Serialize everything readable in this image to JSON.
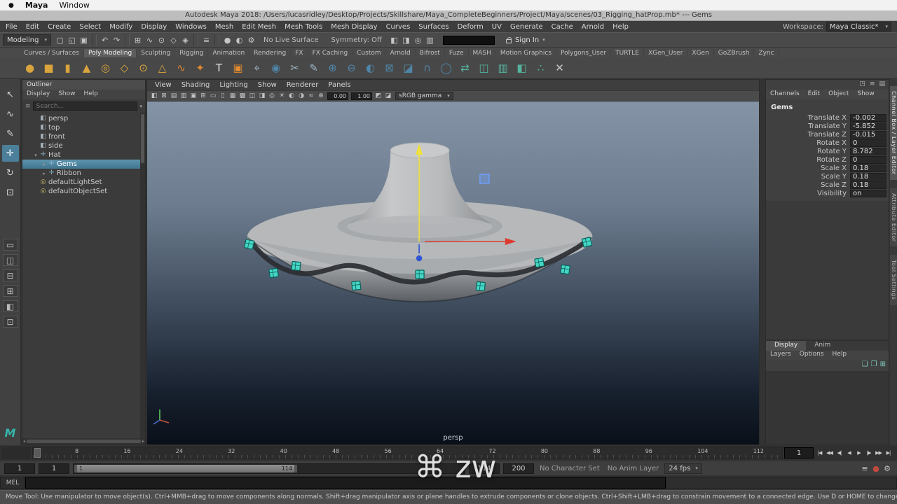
{
  "icons": {
    "chevron_down": "▾",
    "apple": "●",
    "search": "≡"
  },
  "colors": {
    "selection": "#4b7f9a",
    "gem": "#45d6c6",
    "axis_x": "#dd3b2e",
    "axis_y": "#f0e13c",
    "axis_z": "#2f54d6",
    "autokey": "#c2493d"
  },
  "macos_bar": {
    "apple_icon": "●",
    "app_name": "Maya",
    "window_menu": "Window"
  },
  "titlebar": {
    "title": "Autodesk Maya 2018: /Users/lucasridley/Desktop/Projects/Skillshare/Maya_CompleteBeginners/Project/Maya/scenes/03_Rigging_hatProp.mb*  --- Gems"
  },
  "menubar": {
    "items": [
      "File",
      "Edit",
      "Create",
      "Select",
      "Modify",
      "Display",
      "Windows",
      "Mesh",
      "Edit Mesh",
      "Mesh Tools",
      "Mesh Display",
      "Curves",
      "Surfaces",
      "Deform",
      "UV",
      "Generate",
      "Cache",
      "Arnold",
      "Help"
    ],
    "workspace_label": "Workspace:",
    "workspace_value": "Maya Classic*"
  },
  "statusline": {
    "mode": "Modeling",
    "icons": [
      {
        "name": "new-scene-icon",
        "g": "▢"
      },
      {
        "name": "open-scene-icon",
        "g": "◱"
      },
      {
        "name": "save-scene-icon",
        "g": "▣"
      },
      {
        "name": "divider-grip",
        "cls": "divider",
        "g": ""
      },
      {
        "name": "undo-icon",
        "g": "↶"
      },
      {
        "name": "redo-icon",
        "g": "↷"
      },
      {
        "name": "divider-grip",
        "cls": "divider",
        "g": ""
      },
      {
        "name": "snap-grid-icon",
        "g": "⊞"
      },
      {
        "name": "snap-curve-icon",
        "g": "∿"
      },
      {
        "name": "snap-point-icon",
        "g": "⊙"
      },
      {
        "name": "snap-plane-icon",
        "g": "◇"
      },
      {
        "name": "make-live-icon",
        "g": "◈"
      },
      {
        "name": "divider-grip",
        "cls": "divider",
        "g": ""
      },
      {
        "name": "construction-history-icon",
        "g": "≡"
      },
      {
        "name": "divider-grip",
        "cls": "divider",
        "g": ""
      },
      {
        "name": "render-frame-icon",
        "g": "●"
      },
      {
        "name": "ipr-render-icon",
        "g": "◐"
      },
      {
        "name": "render-settings-icon",
        "g": "⚙"
      }
    ],
    "no_live_surface": "No Live Surface",
    "symmetry": "Symmetry: Off",
    "icons_mid": [
      {
        "name": "object-mode-icon",
        "g": "◧"
      },
      {
        "name": "component-mode-icon",
        "g": "◨"
      },
      {
        "name": "highlight-selection-icon",
        "g": "◎"
      },
      {
        "name": "xray-mode-icon",
        "g": "▥"
      }
    ],
    "sign_in": "Sign In"
  },
  "shelf": {
    "tabs": [
      {
        "label": "Curves / Surfaces"
      },
      {
        "label": "Poly Modeling",
        "active": true
      },
      {
        "label": "Sculpting"
      },
      {
        "label": "Rigging"
      },
      {
        "label": "Animation"
      },
      {
        "label": "Rendering"
      },
      {
        "label": "FX"
      },
      {
        "label": "FX Caching"
      },
      {
        "label": "Custom"
      },
      {
        "label": "Arnold"
      },
      {
        "label": "Bifrost"
      },
      {
        "label": "Fuze"
      },
      {
        "label": "MASH"
      },
      {
        "label": "Motion Graphics"
      },
      {
        "label": "Polygons_User"
      },
      {
        "label": "TURTLE"
      },
      {
        "label": "XGen_User"
      },
      {
        "label": "XGen"
      },
      {
        "label": "GoZBrush"
      },
      {
        "label": "Zync"
      }
    ],
    "icons": [
      {
        "name": "poly-sphere-icon",
        "g": "●",
        "c": "#d9a43c"
      },
      {
        "name": "poly-cube-icon",
        "g": "■",
        "c": "#d9a43c"
      },
      {
        "name": "poly-cylinder-icon",
        "g": "▮",
        "c": "#d9a43c"
      },
      {
        "name": "poly-cone-icon",
        "g": "▲",
        "c": "#d9a43c"
      },
      {
        "name": "poly-torus-icon",
        "g": "◎",
        "c": "#d9a43c"
      },
      {
        "name": "poly-plane-icon",
        "g": "◇",
        "c": "#d9a43c"
      },
      {
        "name": "poly-disc-icon",
        "g": "⊙",
        "c": "#d9a43c"
      },
      {
        "name": "poly-pyramid-icon",
        "g": "△",
        "c": "#d9a43c"
      },
      {
        "name": "poly-helix-icon",
        "g": "∿",
        "c": "#e08a2f"
      },
      {
        "name": "super-shape-icon",
        "g": "✦",
        "c": "#e08a2f"
      },
      {
        "name": "type-tool-icon",
        "g": "T",
        "c": "#e6e6e6"
      },
      {
        "name": "image-plane-icon",
        "g": "▣",
        "c": "#e08a2f"
      },
      {
        "name": "center-pivot-icon",
        "g": "⌖",
        "c": "#9fb6c4"
      },
      {
        "name": "magnet-snap-icon",
        "g": "◉",
        "c": "#4f86a8"
      },
      {
        "name": "multi-cut-icon",
        "g": "✂",
        "c": "#9fb6c4"
      },
      {
        "name": "quad-draw-icon",
        "g": "✎",
        "c": "#9fb6c4"
      },
      {
        "name": "combine-icon",
        "g": "⊕",
        "c": "#4f86a8"
      },
      {
        "name": "separate-icon",
        "g": "⊖",
        "c": "#4f86a8"
      },
      {
        "name": "boolean-icon",
        "g": "◐",
        "c": "#4f86a8"
      },
      {
        "name": "extrude-icon",
        "g": "⊠",
        "c": "#4f86a8"
      },
      {
        "name": "bevel-icon",
        "g": "◪",
        "c": "#4f86a8"
      },
      {
        "name": "bridge-icon",
        "g": "∩",
        "c": "#4f86a8"
      },
      {
        "name": "smooth-icon",
        "g": "◯",
        "c": "#4f86a8"
      },
      {
        "name": "mirror-icon",
        "g": "⇄",
        "c": "#55b39e"
      },
      {
        "name": "insert-edge-loop-icon",
        "g": "◫",
        "c": "#55b39e"
      },
      {
        "name": "offset-edge-loop-icon",
        "g": "▥",
        "c": "#55b39e"
      },
      {
        "name": "symmetrize-icon",
        "g": "◧",
        "c": "#55b39e"
      },
      {
        "name": "average-vertices-icon",
        "g": "∴",
        "c": "#55b39e"
      },
      {
        "name": "delete-edge-icon",
        "g": "✕",
        "c": "#c9c9c9"
      }
    ]
  },
  "toolbox": {
    "tools": [
      {
        "name": "select-tool",
        "g": "↖"
      },
      {
        "name": "lasso-tool",
        "g": "∿"
      },
      {
        "name": "paint-select-tool",
        "g": "✎"
      },
      {
        "name": "move-tool",
        "g": "✛",
        "active": true
      },
      {
        "name": "rotate-tool",
        "g": "↻"
      },
      {
        "name": "scale-tool",
        "g": "⊡"
      }
    ],
    "layouts": [
      {
        "name": "layout-single-pane",
        "g": "▭"
      },
      {
        "name": "layout-two-panes-side",
        "g": "◫"
      },
      {
        "name": "layout-two-panes-stacked",
        "g": "⊟"
      },
      {
        "name": "layout-four-panes",
        "g": "⊞"
      },
      {
        "name": "layout-outliner-persp",
        "g": "◧"
      },
      {
        "name": "layout-persp-graph",
        "g": "⊡"
      }
    ],
    "logo": "M"
  },
  "outliner": {
    "title": "Outliner",
    "menus": [
      "Display",
      "Show",
      "Help"
    ],
    "search_placeholder": "Search...",
    "items": [
      {
        "label": "persp",
        "type": "camera",
        "depth": 1,
        "expander": ""
      },
      {
        "label": "top",
        "type": "camera",
        "depth": 1,
        "expander": ""
      },
      {
        "label": "front",
        "type": "camera",
        "depth": 1,
        "expander": ""
      },
      {
        "label": "side",
        "type": "camera",
        "depth": 1,
        "expander": ""
      },
      {
        "label": "Hat",
        "type": "transform",
        "depth": 1,
        "expander": "▾"
      },
      {
        "label": "Gems",
        "type": "transform",
        "depth": 2,
        "expander": "▸",
        "selected": true
      },
      {
        "label": "Ribbon",
        "type": "transform",
        "depth": 2,
        "expander": "▸"
      },
      {
        "label": "defaultLightSet",
        "type": "set",
        "depth": 1,
        "expander": ""
      },
      {
        "label": "defaultObjectSet",
        "type": "set",
        "depth": 1,
        "expander": ""
      }
    ]
  },
  "viewport": {
    "menus": [
      "View",
      "Shading",
      "Lighting",
      "Show",
      "Renderer",
      "Panels"
    ],
    "toolbar_icons": [
      {
        "name": "select-camera-icon",
        "g": "◧"
      },
      {
        "name": "lock-camera-icon",
        "g": "⊠"
      },
      {
        "name": "camera-attributes-icon",
        "g": "▤"
      },
      {
        "name": "bookmarks-icon",
        "g": "▥"
      },
      {
        "name": "image-plane-icon",
        "g": "▣"
      },
      {
        "name": "view-grid-icon",
        "g": "⊞"
      },
      {
        "name": "film-gate-icon",
        "g": "▭"
      },
      {
        "name": "resolution-gate-icon",
        "g": "▯"
      },
      {
        "name": "gate-mask-icon",
        "g": "▦"
      },
      {
        "name": "field-chart-icon",
        "g": "▩"
      },
      {
        "name": "safe-action-icon",
        "g": "◫"
      },
      {
        "name": "safe-title-icon",
        "g": "◨"
      },
      {
        "name": "frame-all-icon",
        "g": "◎"
      },
      {
        "name": "lighting-icon",
        "g": "☀"
      },
      {
        "name": "shadows-icon",
        "g": "◐"
      },
      {
        "name": "ambient-occlusion-icon",
        "g": "◑"
      },
      {
        "name": "motion-blur-icon",
        "g": "≈"
      },
      {
        "name": "anti-aliasing-icon",
        "g": "⊕"
      }
    ],
    "exposure": "0.00",
    "gamma": "1.00",
    "toolbar_icons_right": [
      {
        "name": "exposure-icon",
        "g": "◩"
      },
      {
        "name": "gamma-icon",
        "g": "◪"
      }
    ],
    "colorspace": "sRGB gamma",
    "camera_label": "persp"
  },
  "channelbox": {
    "corner_icons": [
      {
        "name": "pin-panel-icon",
        "g": "◳"
      },
      {
        "name": "panel-menu-icon",
        "g": "≡"
      },
      {
        "name": "display-mode-icon",
        "g": "▤"
      }
    ],
    "menus": [
      "Channels",
      "Edit",
      "Object",
      "Show"
    ],
    "object_name": "Gems",
    "rows": [
      {
        "label": "Translate X",
        "value": "-0.002"
      },
      {
        "label": "Translate Y",
        "value": "-5.852"
      },
      {
        "label": "Translate Z",
        "value": "-0.015"
      },
      {
        "label": "Rotate X",
        "value": "0"
      },
      {
        "label": "Rotate Y",
        "value": "8.782"
      },
      {
        "label": "Rotate Z",
        "value": "0"
      },
      {
        "label": "Scale X",
        "value": "0.18"
      },
      {
        "label": "Scale Y",
        "value": "0.18"
      },
      {
        "label": "Scale Z",
        "value": "0.18"
      },
      {
        "label": "Visibility",
        "value": "on"
      }
    ],
    "layer_editor": {
      "tabs": [
        {
          "label": "Display",
          "active": true
        },
        {
          "label": "Anim"
        }
      ],
      "menus": [
        "Layers",
        "Options",
        "Help"
      ],
      "buttons": [
        {
          "name": "toggle-layer-icon",
          "g": "❏"
        },
        {
          "name": "new-empty-layer-icon",
          "g": "❐"
        },
        {
          "name": "new-layer-from-selected-icon",
          "g": "⊞"
        }
      ]
    }
  },
  "right_tabs": [
    {
      "label": "Channel Box / Layer Editor",
      "active": true
    },
    {
      "label": "Attribute Editor"
    },
    {
      "label": "Tool Settings"
    }
  ],
  "timeline": {
    "tick_labels": [
      "8",
      "16",
      "24",
      "32",
      "40",
      "48",
      "56",
      "64",
      "72",
      "80",
      "88",
      "96",
      "104",
      "112"
    ],
    "current_frame": "1",
    "playback": [
      {
        "name": "go-to-start-button",
        "g": "|◀"
      },
      {
        "name": "step-back-key-button",
        "g": "◀◀"
      },
      {
        "name": "step-back-frame-button",
        "g": "◀|"
      },
      {
        "name": "play-backwards-button",
        "g": "◀"
      },
      {
        "name": "play-forwards-button",
        "g": "▶"
      },
      {
        "name": "step-forward-frame-button",
        "g": "|▶"
      },
      {
        "name": "step-forward-key-button",
        "g": "▶▶"
      },
      {
        "name": "go-to-end-button",
        "g": "▶|"
      }
    ]
  },
  "range_slider": {
    "anim_start_field": "1",
    "playback_start_field": "1",
    "range_start_label": "1",
    "range_end_label": "114",
    "playback_end_field": "114",
    "anim_end_field": "200",
    "character_set": "No Character Set",
    "anim_layer": "No Anim Layer",
    "fps": "24 fps",
    "icons": [
      {
        "name": "character-set-menu-icon",
        "g": "≡"
      },
      {
        "name": "auto-keyframe-icon",
        "g": "●",
        "cls": "autokey"
      },
      {
        "name": "animation-preferences-icon",
        "g": "⚙"
      }
    ]
  },
  "command_line": {
    "label": "MEL"
  },
  "help_line": {
    "text": "Move Tool: Use manipulator to move object(s). Ctrl+MMB+drag to move components along normals. Shift+drag manipulator axis or plane handles to extrude components or clone objects. Ctrl+Shift+LMB+drag to constrain movement to a connected edge. Use D or HOME to change the pivot position and axis orientation."
  },
  "key_overlay": {
    "keys": "⌘ zw"
  }
}
